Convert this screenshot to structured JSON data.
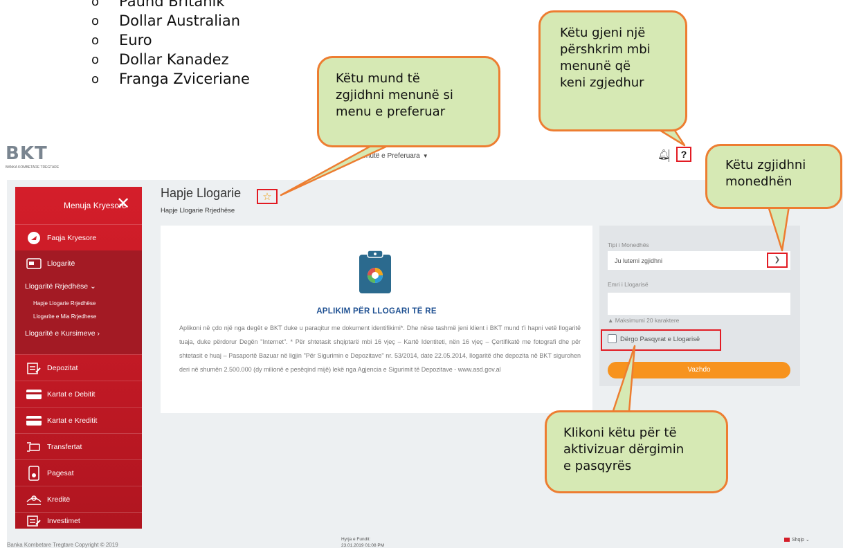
{
  "document": {
    "currency_list": [
      "Paund Britanik",
      "Dollar Australian",
      "Euro",
      "Dollar Kanadez",
      "Franga Zviceriane"
    ]
  },
  "header": {
    "logo_text": "BKT",
    "logo_subtitle": "BANKA KOMBETARE TREGTARE",
    "favorites_menu": "Menutë e Preferuara",
    "help_label": "?"
  },
  "sidebar": {
    "title": "Menuja Kryesore",
    "items": [
      {
        "label": "Faqja Kryesore",
        "icon": "home-icon"
      },
      {
        "label": "Llogaritë",
        "icon": "accounts-icon"
      },
      {
        "label": "Depozitat",
        "icon": "deposit-icon"
      },
      {
        "label": "Kartat e Debitit",
        "icon": "debit-card-icon"
      },
      {
        "label": "Kartat e Kreditit",
        "icon": "credit-card-icon"
      },
      {
        "label": "Transfertat",
        "icon": "transfer-icon"
      },
      {
        "label": "Pagesat",
        "icon": "payment-icon"
      },
      {
        "label": "Kreditë",
        "icon": "loan-icon"
      },
      {
        "label": "Investimet",
        "icon": "investment-icon"
      }
    ],
    "current_accounts": "Llogaritë Rrjedhëse",
    "open_current_account": "Hapje Llogarie Rrjedhëse",
    "my_current_accounts": "Llogarite e Mia Rrjedhese",
    "savings_accounts": "Llogaritë e Kursimeve"
  },
  "page": {
    "title": "Hapje Llogarie",
    "subtitle": "Hapje Llogarie Rrjedhëse"
  },
  "card": {
    "heading": "APLIKIM PËR LLOGARI TË RE",
    "text": "Aplikoni në çdo një nga degët e BKT duke u paraqitur me dokument identifikimi*. Dhe nëse tashmë jeni klient i BKT mund t'i hapni vetë llogaritë tuaja, duke përdorur Degën \"Internet\". * Për shtetasit shqiptarë mbi 16 vjeç – Kartë Identiteti, nën 16 vjeç – Çertifikatë me fotografi dhe për shtetasit e huaj – Pasaportë Bazuar në ligjin \"Për Sigurimin e Depozitave\" nr. 53/2014, date 22.05.2014, llogaritë dhe depozita në BKT sigurohen deri në shumën 2.500.000 (dy milionë e pesëqind mijë) lekë nga Agjencia e Sigurimit të Depozitave - www.asd.gov.al"
  },
  "form": {
    "currency_label": "Tipi i Monedhës",
    "currency_value": "Ju lutemi zgjidhni",
    "account_name_label": "Emri i Llogarisë",
    "account_name_value": "",
    "max_hint": "Maksimumi 20 karaktere",
    "send_statement_label": "Dërgo Pasqyrat e Llogarisë",
    "send_statement_checked": false,
    "continue_button": "Vazhdo"
  },
  "footer": {
    "copyright": "Banka Kombetare Tregtare Copyright © 2019",
    "last_login_label": "Hyrja e Fundit:",
    "last_login_value": "23.01.2019 01:08 PM",
    "language": "Shqip"
  },
  "callouts": {
    "favorite": "Këtu mund të\nzgjidhni menunë si\nmenu e preferuar",
    "help": "Këtu gjeni një\npërshkrim mbi\nmenunë që\nkeni zgjedhur",
    "currency": "Këtu zgjidhni\nmonedhën",
    "statement": "Klikoni këtu për të\naktivizuar dërgimin\ne pasqyrës"
  },
  "colors": {
    "brand_red": "#d41e2a",
    "accent_orange": "#f7931e",
    "heading_blue": "#1d4f91",
    "callout_fill": "#d6e9b4",
    "callout_border": "#ed7d31",
    "highlight_red": "#e21b23"
  }
}
